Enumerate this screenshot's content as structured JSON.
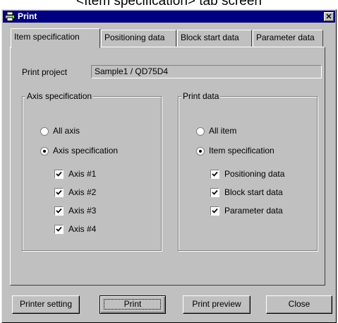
{
  "caption": "<Item specification> tab screen",
  "window": {
    "title": "Print",
    "close_glyph": "✕",
    "icon": "printer-icon"
  },
  "tabs": [
    {
      "label": "Item specification",
      "active": true
    },
    {
      "label": "Positioning data",
      "active": false
    },
    {
      "label": "Block start data",
      "active": false
    },
    {
      "label": "Parameter data",
      "active": false
    }
  ],
  "print_project": {
    "label": "Print project",
    "value": "Sample1 / QD75D4"
  },
  "axis_group": {
    "legend": "Axis specification",
    "radios": [
      {
        "label": "All axis",
        "selected": false
      },
      {
        "label": "Axis specification",
        "selected": true
      }
    ],
    "checks": [
      {
        "label": "Axis #1",
        "checked": true
      },
      {
        "label": "Axis #2",
        "checked": true
      },
      {
        "label": "Axis #3",
        "checked": true
      },
      {
        "label": "Axis #4",
        "checked": true
      }
    ]
  },
  "print_group": {
    "legend": "Print data",
    "radios": [
      {
        "label": "All item",
        "selected": false
      },
      {
        "label": "Item specification",
        "selected": true
      }
    ],
    "checks": [
      {
        "label": "Positioning data",
        "checked": true
      },
      {
        "label": "Block start data",
        "checked": true
      },
      {
        "label": "Parameter data",
        "checked": true
      }
    ]
  },
  "buttons": {
    "printer_setting": "Printer setting",
    "print": "Print",
    "print_preview": "Print preview",
    "close": "Close"
  }
}
